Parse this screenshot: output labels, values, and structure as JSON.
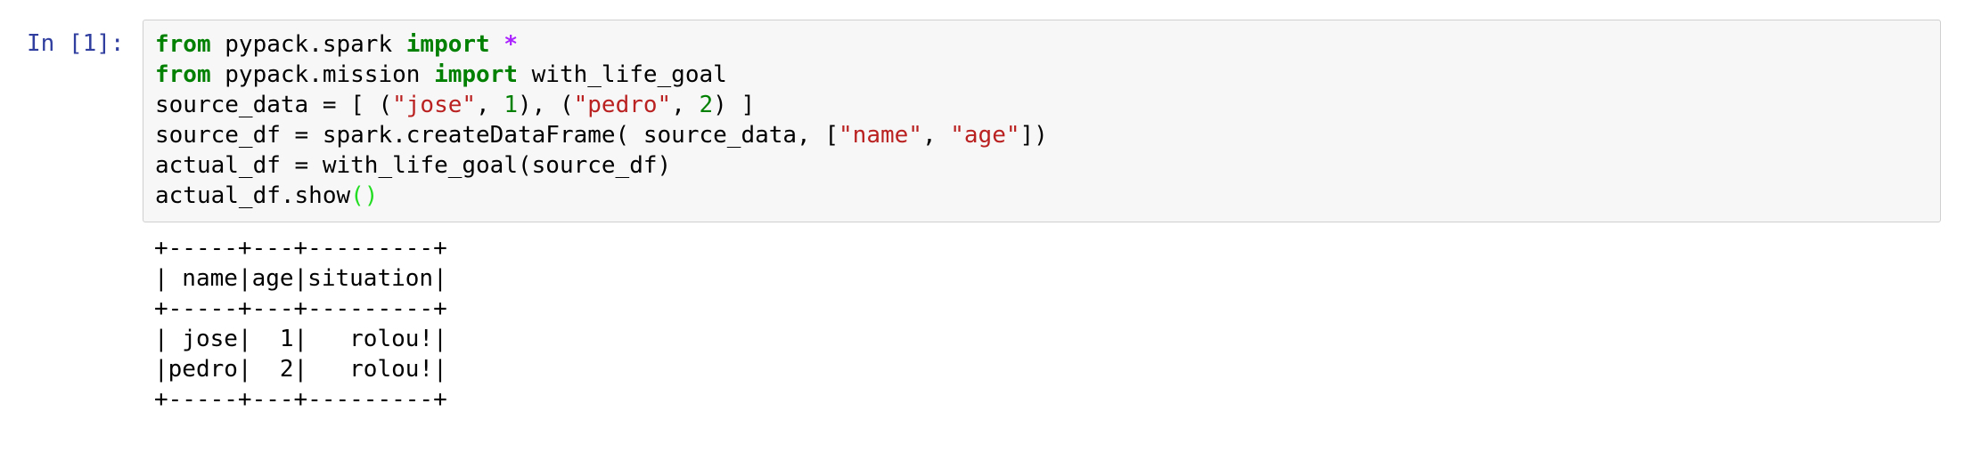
{
  "cell": {
    "prompt": "In [1]:",
    "code": {
      "line1": {
        "kw1": "from",
        "mod": " pypack.spark ",
        "kw2": "import",
        "sp": " ",
        "star": "*"
      },
      "line2": {
        "kw1": "from",
        "mod": " pypack.mission ",
        "kw2": "import",
        "rest": " with_life_goal"
      },
      "line3": {
        "a": "source_data = [ (",
        "s1": "\"jose\"",
        "b": ", ",
        "n1": "1",
        "c": "), (",
        "s2": "\"pedro\"",
        "d": ", ",
        "n2": "2",
        "e": ") ]"
      },
      "line4": {
        "a": "source_df = spark.createDataFrame( source_data, [",
        "s1": "\"name\"",
        "b": ", ",
        "s2": "\"age\"",
        "c": "])"
      },
      "line5": "actual_df = with_life_goal(source_df)",
      "line6": {
        "a": "actual_df.show",
        "paren": "()"
      }
    },
    "output": {
      "lines": [
        "+-----+---+---------+",
        "| name|age|situation|",
        "+-----+---+---------+",
        "| jose|  1|   rolou!|",
        "|pedro|  2|   rolou!|",
        "+-----+---+---------+"
      ]
    }
  },
  "colors": {
    "prompt": "#303f9f",
    "keyword": "#008000",
    "string": "#ba2121",
    "number": "#008000",
    "operator": "#aa22ff",
    "input_background": "#f7f7f7",
    "input_border": "#cfcfcf"
  }
}
